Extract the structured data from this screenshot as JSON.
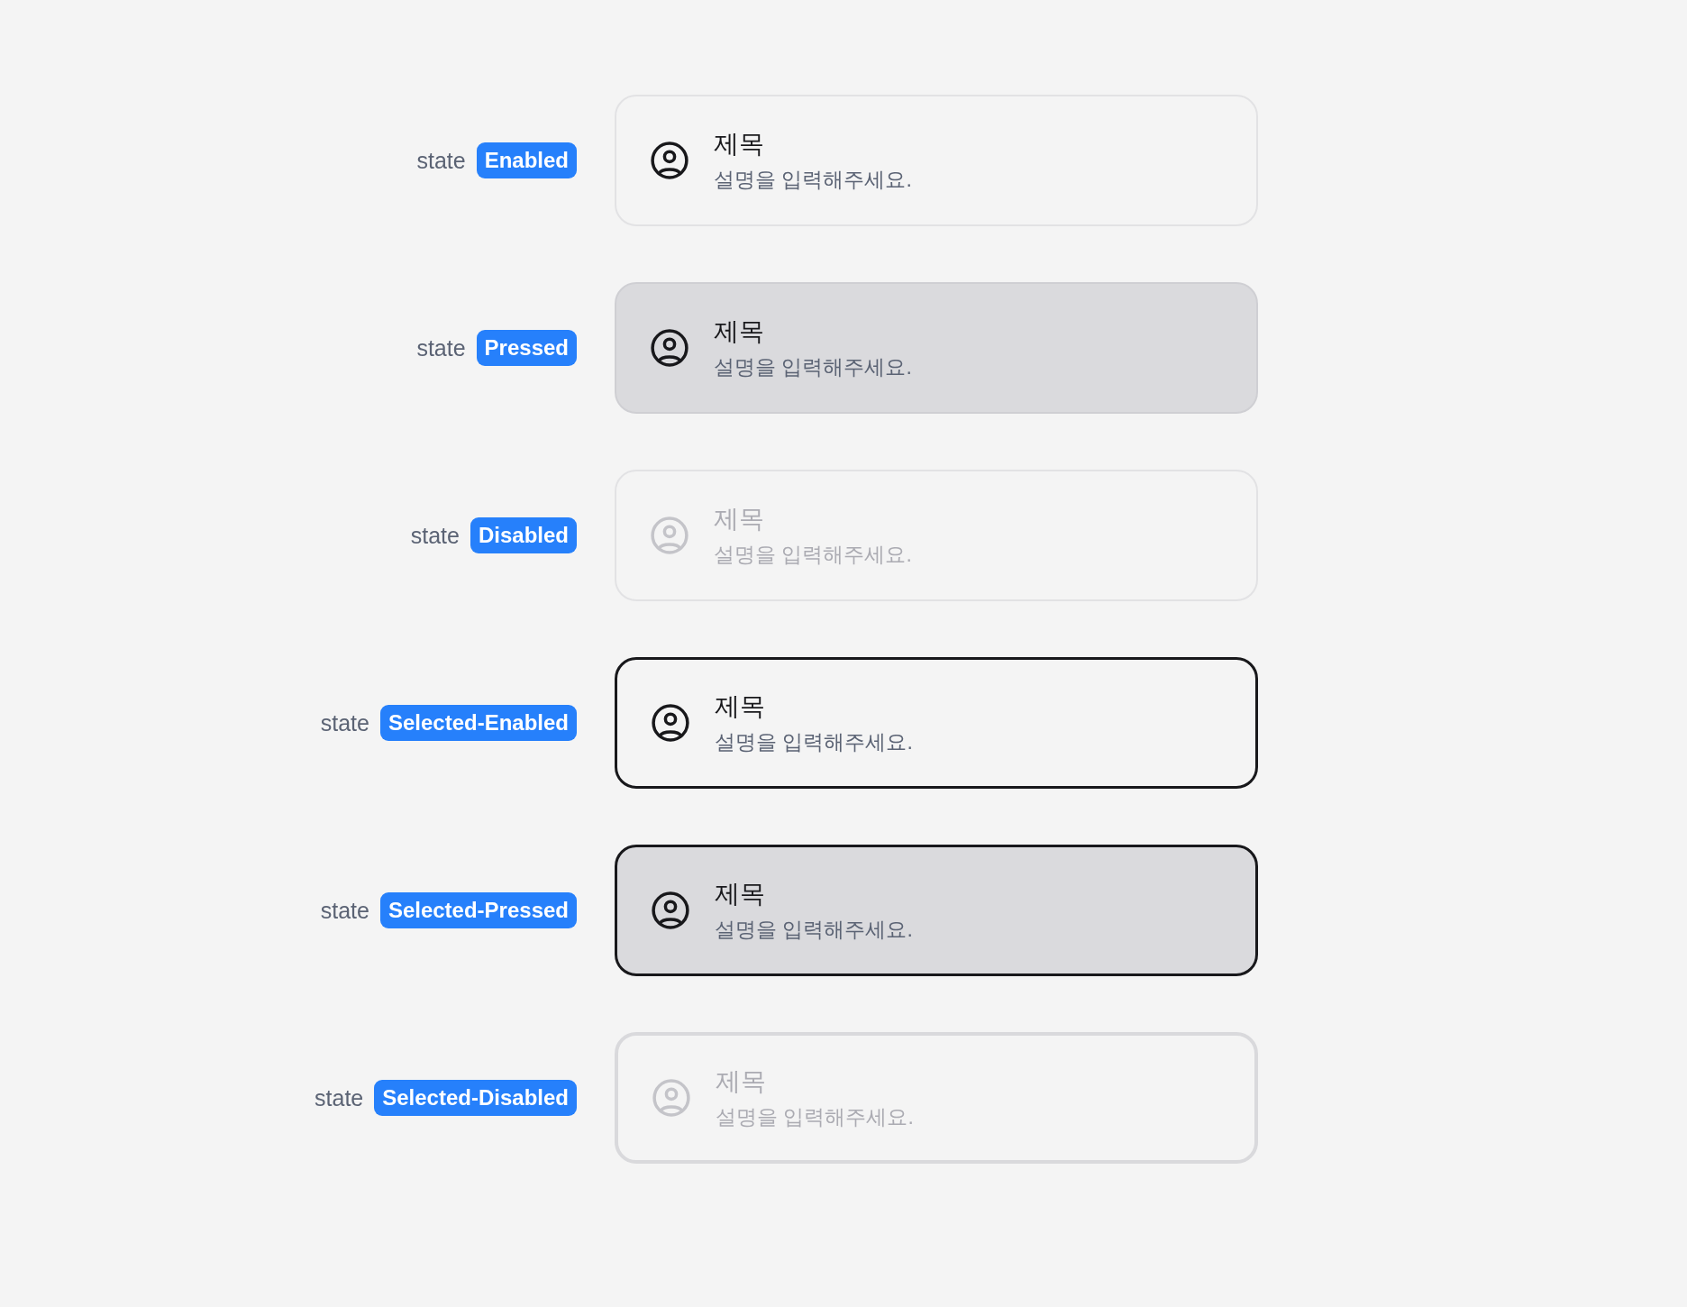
{
  "rows": [
    {
      "label": "state",
      "badge": "Enabled",
      "card": {
        "title": "제목",
        "description": "설명을 입력해주세요.",
        "selected": false,
        "pressed": false,
        "disabled": false
      }
    },
    {
      "label": "state",
      "badge": "Pressed",
      "card": {
        "title": "제목",
        "description": "설명을 입력해주세요.",
        "selected": false,
        "pressed": true,
        "disabled": false
      }
    },
    {
      "label": "state",
      "badge": "Disabled",
      "card": {
        "title": "제목",
        "description": "설명을 입력해주세요.",
        "selected": false,
        "pressed": false,
        "disabled": true
      }
    },
    {
      "label": "state",
      "badge": "Selected-Enabled",
      "card": {
        "title": "제목",
        "description": "설명을 입력해주세요.",
        "selected": true,
        "pressed": false,
        "disabled": false
      }
    },
    {
      "label": "state",
      "badge": "Selected-Pressed",
      "card": {
        "title": "제목",
        "description": "설명을 입력해주세요.",
        "selected": true,
        "pressed": true,
        "disabled": false
      }
    },
    {
      "label": "state",
      "badge": "Selected-Disabled",
      "card": {
        "title": "제목",
        "description": "설명을 입력해주세요.",
        "selected": true,
        "pressed": false,
        "disabled": true
      }
    }
  ]
}
